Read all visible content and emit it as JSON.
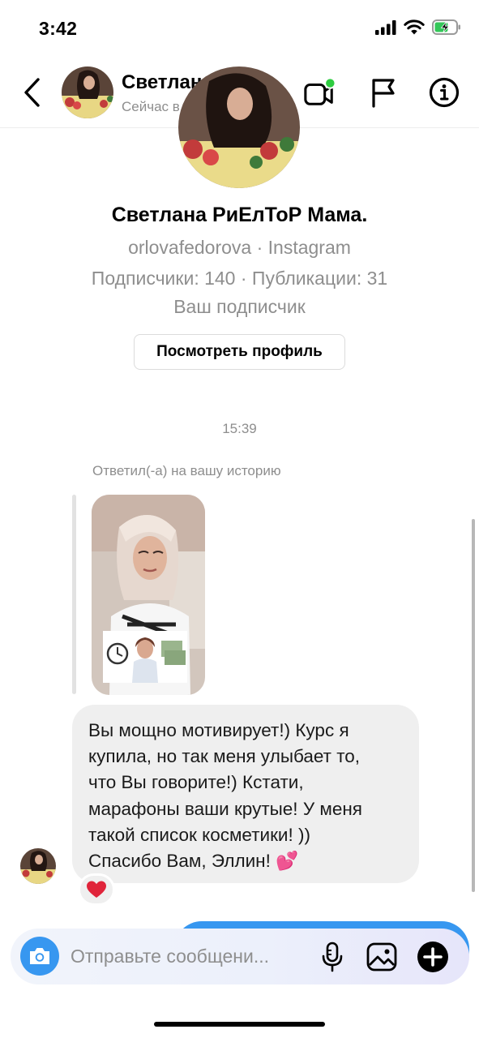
{
  "status_bar": {
    "time": "3:42"
  },
  "header": {
    "name": "Светлана РиЕ…",
    "status": "Сейчас в сети"
  },
  "profile": {
    "name": "Светлана РиЕлТоР Мама.",
    "handle_line": "orlovafedorova · Instagram",
    "stats_line": "Подписчики: 140 · Публикации: 31",
    "relation": "Ваш подписчик",
    "view_profile_label": "Посмотреть профиль"
  },
  "thread": {
    "timestamp": "15:39",
    "reply_label": "Ответил(-а) на вашу историю",
    "message_lines": [
      "Вы мощно мотивирует!) Курс я",
      "купила, но так меня улыбает то,",
      "что Вы говорите!) Кстати,",
      "марафоны ваши крутые! У меня",
      "такой список косметики! ))",
      "Спасибо Вам, Эллин! 💕"
    ],
    "reaction": "❤️"
  },
  "composer": {
    "placeholder": "Отправьте сообщени..."
  },
  "colors": {
    "accent_blue": "#3797f0",
    "online_green": "#2ecc40",
    "bubble_gray": "#efefef",
    "secondary_text": "#8e8e8e"
  },
  "icons": {
    "back": "chevron-left-icon",
    "video": "video-call-icon",
    "report": "flag-icon",
    "info": "info-icon",
    "camera": "camera-icon",
    "mic": "microphone-icon",
    "gallery": "gallery-icon",
    "add": "plus-circle-icon"
  }
}
